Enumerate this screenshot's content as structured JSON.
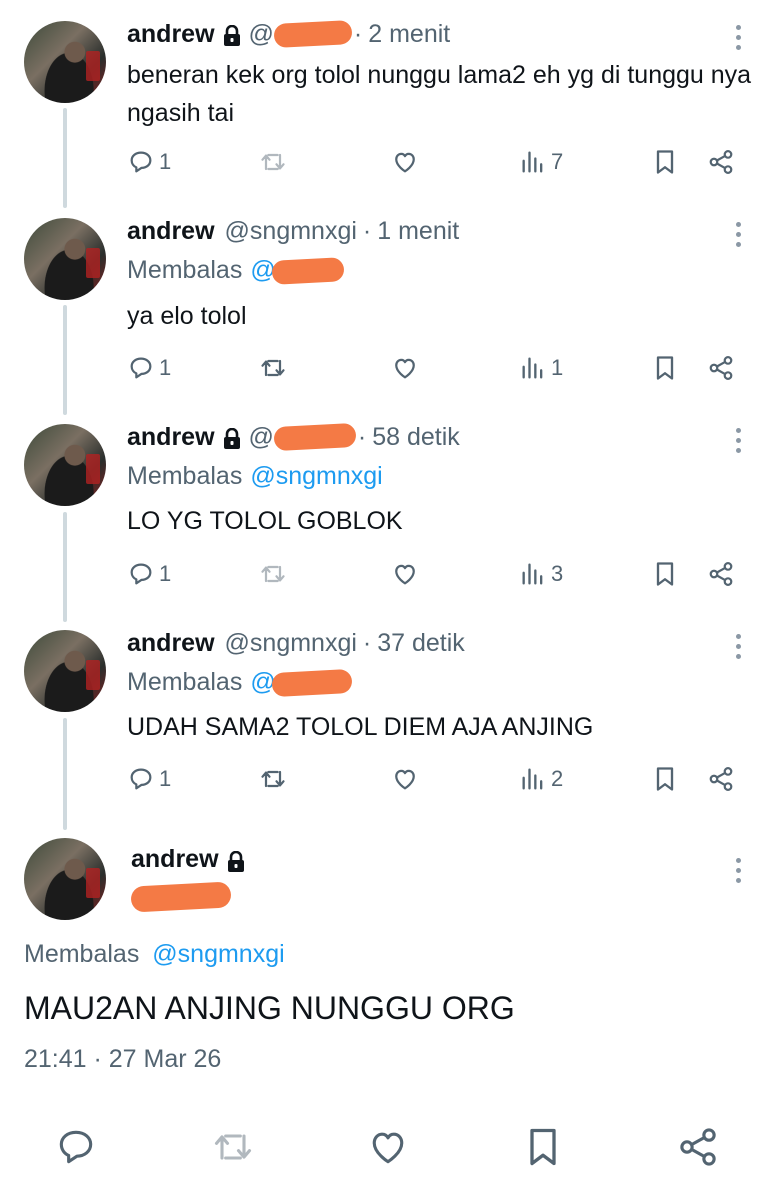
{
  "tweets": [
    {
      "name": "andrew",
      "handle": "@",
      "time": "2 menit",
      "reply_label": "",
      "reply_mention": "",
      "text": "beneran kek org tolol nunggu lama2 eh yg di tunggu nya ngasih tai",
      "replies": "1",
      "retweets": "",
      "views": "7"
    },
    {
      "name": "andrew",
      "handle": "@sngmnxgi",
      "time": "1 menit",
      "reply_label": "Membalas",
      "reply_mention": "@",
      "text": "ya elo tolol",
      "replies": "1",
      "retweets": "",
      "views": "1"
    },
    {
      "name": "andrew",
      "handle": "@",
      "time": "58 detik",
      "reply_label": "Membalas",
      "reply_mention": "@sngmnxgi",
      "text": "LO YG TOLOL GOBLOK",
      "replies": "1",
      "retweets": "",
      "views": "3"
    },
    {
      "name": "andrew",
      "handle": "@sngmnxgi",
      "time": "37 detik",
      "reply_label": "Membalas",
      "reply_mention": "@",
      "text": "UDAH SAMA2 TOLOL DIEM AJA ANJING",
      "replies": "1",
      "retweets": "",
      "views": "2"
    }
  ],
  "main_tweet": {
    "name": "andrew",
    "reply_label": "Membalas",
    "reply_mention": "@sngmnxgi",
    "text": "MAU2AN ANJING NUNGGU ORG",
    "timestamp": "21:41 · 27 Mar 26"
  },
  "dot": "·",
  "colors": {
    "redaction": "#f47a45",
    "mention": "#1d9bf0",
    "muted": "#536471",
    "thread_line": "#cfd9de"
  },
  "icons": [
    "lock-icon",
    "more-icon",
    "reply-icon",
    "retweet-icon",
    "like-icon",
    "views-icon",
    "bookmark-icon",
    "share-icon"
  ]
}
